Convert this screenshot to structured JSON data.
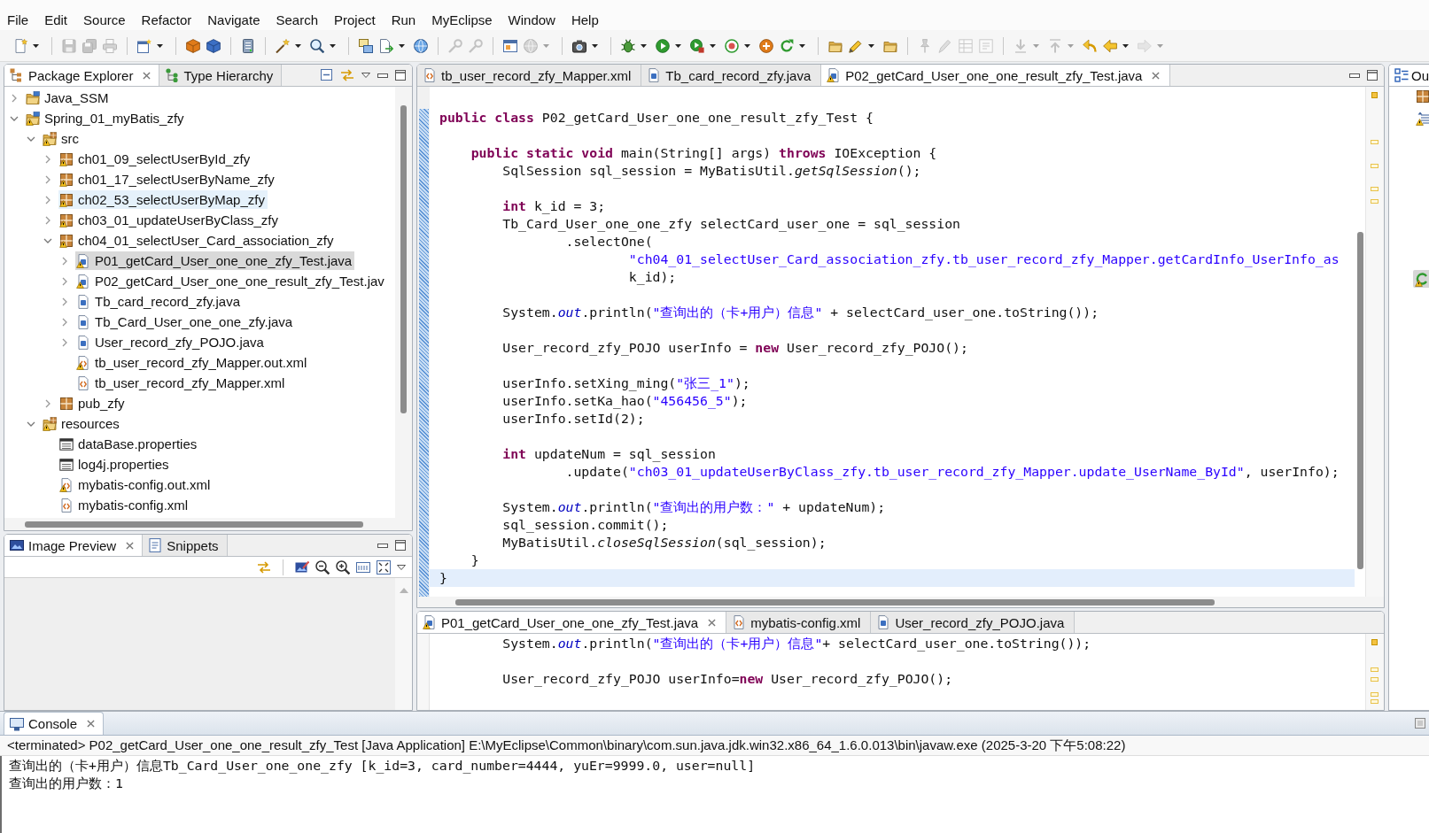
{
  "menu": {
    "items": [
      "File",
      "Edit",
      "Source",
      "Refactor",
      "Navigate",
      "Search",
      "Project",
      "Run",
      "MyEclipse",
      "Window",
      "Help"
    ]
  },
  "toolbar": {
    "buttons": [
      {
        "disabled": false
      },
      {
        "disabled": true
      },
      {
        "disabled": true
      },
      {
        "disabled": true
      },
      {
        "disabled": false
      },
      {
        "disabled": false
      },
      {
        "disabled": false
      },
      {
        "disabled": false
      },
      {
        "disabled": false
      },
      {
        "disabled": false
      },
      {
        "disabled": false
      },
      {
        "disabled": false
      },
      {
        "disabled": false
      },
      {
        "disabled": true
      },
      {
        "disabled": true
      },
      {
        "disabled": false
      },
      {
        "disabled": true
      },
      {
        "disabled": false
      },
      {
        "disabled": false
      },
      {
        "disabled": false
      },
      {
        "disabled": false
      },
      {
        "disabled": false
      },
      {
        "disabled": false
      },
      {
        "disabled": false
      },
      {
        "disabled": false
      },
      {
        "disabled": false
      },
      {
        "disabled": false
      },
      {
        "disabled": true
      },
      {
        "disabled": true
      },
      {
        "disabled": true
      },
      {
        "disabled": true
      },
      {
        "disabled": true
      },
      {
        "disabled": true
      },
      {
        "disabled": false
      },
      {
        "disabled": false
      },
      {
        "disabled": true
      }
    ]
  },
  "package_explorer": {
    "tabs": [
      {
        "label": "Package Explorer",
        "selected": true
      },
      {
        "label": "Type Hierarchy",
        "selected": false
      }
    ],
    "tree": [
      {
        "label": "Java_SSM",
        "kind": "project",
        "expanded": false,
        "warning": false,
        "selected": false,
        "hovered": false
      },
      {
        "label": "Spring_01_myBatis_zfy",
        "kind": "project",
        "expanded": true,
        "warning": true,
        "selected": false,
        "hovered": false,
        "children": [
          {
            "label": "src",
            "kind": "source-folder",
            "expanded": true,
            "warning": true,
            "selected": false,
            "hovered": false,
            "children": [
              {
                "label": "ch01_09_selectUserById_zfy",
                "kind": "package",
                "expanded": false,
                "warning": true,
                "selected": false,
                "hovered": false
              },
              {
                "label": "ch01_17_selectUserByName_zfy",
                "kind": "package",
                "expanded": false,
                "warning": true,
                "selected": false,
                "hovered": false
              },
              {
                "label": "ch02_53_selectUserByMap_zfy",
                "kind": "package",
                "expanded": false,
                "warning": true,
                "selected": false,
                "hovered": true
              },
              {
                "label": "ch03_01_updateUserByClass_zfy",
                "kind": "package",
                "expanded": false,
                "warning": true,
                "selected": false,
                "hovered": false
              },
              {
                "label": "ch04_01_selectUser_Card_association_zfy",
                "kind": "package",
                "expanded": true,
                "warning": true,
                "selected": false,
                "hovered": false,
                "children": [
                  {
                    "label": "P01_getCard_User_one_one_zfy_Test.java",
                    "kind": "java",
                    "expanded": false,
                    "warning": true,
                    "selected": true,
                    "hovered": false
                  },
                  {
                    "label": "P02_getCard_User_one_one_result_zfy_Test.jav",
                    "kind": "java",
                    "expanded": false,
                    "warning": true,
                    "selected": false,
                    "hovered": false
                  },
                  {
                    "label": "Tb_card_record_zfy.java",
                    "kind": "java",
                    "expanded": false,
                    "warning": false,
                    "selected": false,
                    "hovered": false
                  },
                  {
                    "label": "Tb_Card_User_one_one_zfy.java",
                    "kind": "java",
                    "expanded": false,
                    "warning": false,
                    "selected": false,
                    "hovered": false
                  },
                  {
                    "label": "User_record_zfy_POJO.java",
                    "kind": "java",
                    "expanded": false,
                    "warning": false,
                    "selected": false,
                    "hovered": false
                  },
                  {
                    "label": "tb_user_record_zfy_Mapper.out.xml",
                    "kind": "xml",
                    "warning": true,
                    "selected": false,
                    "hovered": false
                  },
                  {
                    "label": "tb_user_record_zfy_Mapper.xml",
                    "kind": "xml",
                    "warning": false,
                    "selected": false,
                    "hovered": false
                  }
                ]
              },
              {
                "label": "pub_zfy",
                "kind": "package",
                "expanded": false,
                "warning": false,
                "selected": false,
                "hovered": false
              }
            ]
          },
          {
            "label": "resources",
            "kind": "source-folder",
            "expanded": true,
            "warning": true,
            "selected": false,
            "hovered": false,
            "children": [
              {
                "label": "dataBase.properties",
                "kind": "properties",
                "warning": false,
                "selected": false,
                "hovered": false
              },
              {
                "label": "log4j.properties",
                "kind": "properties",
                "warning": false,
                "selected": false,
                "hovered": false
              },
              {
                "label": "mybatis-config.out.xml",
                "kind": "xml",
                "warning": true,
                "selected": false,
                "hovered": false
              },
              {
                "label": "mybatis-config.xml",
                "kind": "xml",
                "warning": false,
                "selected": false,
                "hovered": false
              }
            ]
          }
        ]
      }
    ]
  },
  "image_preview": {
    "tabs": [
      {
        "label": "Image Preview",
        "selected": true
      },
      {
        "label": "Snippets",
        "selected": false
      }
    ]
  },
  "editor": {
    "tabs": [
      {
        "label": "tb_user_record_zfy_Mapper.xml",
        "kind": "xml",
        "warning": false,
        "selected": false
      },
      {
        "label": "Tb_card_record_zfy.java",
        "kind": "java",
        "warning": false,
        "selected": false
      },
      {
        "label": "P02_getCard_User_one_one_result_zfy_Test.java",
        "kind": "java",
        "warning": true,
        "selected": true
      }
    ],
    "blocks": [
      {
        "lines": [
          {
            "tokens": [
              {
                "kind": "keyword",
                "text": "public class"
              },
              {
                "kind": "plain",
                "text": " P02_getCard_User_one_one_result_zfy_Test {"
              }
            ],
            "current": false
          }
        ]
      },
      {
        "lines": [
          {
            "tokens": [
              {
                "kind": "keyword",
                "text": "    public static void"
              },
              {
                "kind": "plain",
                "text": " main(String[] args) "
              },
              {
                "kind": "keyword",
                "text": "throws"
              },
              {
                "kind": "plain",
                "text": " IOException {"
              }
            ],
            "current": false
          },
          {
            "tokens": [
              {
                "kind": "plain",
                "text": "        SqlSession sql_session = MyBatisUtil."
              },
              {
                "kind": "static",
                "text": "getSqlSession"
              },
              {
                "kind": "plain",
                "text": "();"
              }
            ],
            "current": false
          }
        ]
      },
      {
        "lines": [
          {
            "tokens": [
              {
                "kind": "keyword",
                "text": "        int"
              },
              {
                "kind": "plain",
                "text": " k_id = 3;"
              }
            ],
            "current": false
          },
          {
            "tokens": [
              {
                "kind": "plain",
                "text": "        Tb_Card_User_one_one_zfy selectCard_user_one = sql_session"
              }
            ],
            "current": false
          },
          {
            "tokens": [
              {
                "kind": "plain",
                "text": "                .selectOne("
              }
            ],
            "current": false
          },
          {
            "tokens": [
              {
                "kind": "string",
                "text": "                        \"ch04_01_selectUser_Card_association_zfy.tb_user_record_zfy_Mapper.getCardInfo_UserInfo_as"
              }
            ],
            "current": false
          },
          {
            "tokens": [
              {
                "kind": "plain",
                "text": "                        k_id);"
              }
            ],
            "current": false
          }
        ]
      },
      {
        "lines": [
          {
            "tokens": [
              {
                "kind": "plain",
                "text": "        System."
              },
              {
                "kind": "field",
                "text": "out"
              },
              {
                "kind": "plain",
                "text": ".println("
              },
              {
                "kind": "string",
                "text": "\"查询出的（卡+用户）信息\""
              },
              {
                "kind": "plain",
                "text": " + selectCard_user_one.toString());"
              }
            ],
            "current": false
          }
        ]
      },
      {
        "lines": [
          {
            "tokens": [
              {
                "kind": "plain",
                "text": "        User_record_zfy_POJO userInfo = "
              },
              {
                "kind": "keyword",
                "text": "new"
              },
              {
                "kind": "plain",
                "text": " User_record_zfy_POJO();"
              }
            ],
            "current": false
          }
        ]
      },
      {
        "lines": [
          {
            "tokens": [
              {
                "kind": "plain",
                "text": "        userInfo.setXing_ming("
              },
              {
                "kind": "string",
                "text": "\"张三_1\""
              },
              {
                "kind": "plain",
                "text": ");"
              }
            ],
            "current": false
          },
          {
            "tokens": [
              {
                "kind": "plain",
                "text": "        userInfo.setKa_hao("
              },
              {
                "kind": "string",
                "text": "\"456456_5\""
              },
              {
                "kind": "plain",
                "text": ");"
              }
            ],
            "current": false
          },
          {
            "tokens": [
              {
                "kind": "plain",
                "text": "        userInfo.setId(2);"
              }
            ],
            "current": false
          }
        ]
      },
      {
        "lines": [
          {
            "tokens": [
              {
                "kind": "keyword",
                "text": "        int"
              },
              {
                "kind": "plain",
                "text": " updateNum = sql_session"
              }
            ],
            "current": false
          },
          {
            "tokens": [
              {
                "kind": "plain",
                "text": "                .update("
              },
              {
                "kind": "string",
                "text": "\"ch03_01_updateUserByClass_zfy.tb_user_record_zfy_Mapper.update_UserName_ById\""
              },
              {
                "kind": "plain",
                "text": ", userInfo);"
              }
            ],
            "current": false
          }
        ]
      },
      {
        "lines": [
          {
            "tokens": [
              {
                "kind": "plain",
                "text": "        System."
              },
              {
                "kind": "field",
                "text": "out"
              },
              {
                "kind": "plain",
                "text": ".println("
              },
              {
                "kind": "string",
                "text": "\"查询出的用户数：\""
              },
              {
                "kind": "plain",
                "text": " + updateNum);"
              }
            ],
            "current": false
          },
          {
            "tokens": [
              {
                "kind": "plain",
                "text": "        sql_session.commit();"
              }
            ],
            "current": false
          },
          {
            "tokens": [
              {
                "kind": "plain",
                "text": "        MyBatisUtil."
              },
              {
                "kind": "static",
                "text": "closeSqlSession"
              },
              {
                "kind": "plain",
                "text": "(sql_session);"
              }
            ],
            "current": false
          },
          {
            "tokens": [
              {
                "kind": "plain",
                "text": "    }"
              }
            ],
            "current": false
          },
          {
            "tokens": [
              {
                "kind": "plain",
                "text": "}"
              }
            ],
            "current": true
          }
        ]
      }
    ]
  },
  "lower_editor": {
    "tabs": [
      {
        "label": "P01_getCard_User_one_one_zfy_Test.java",
        "kind": "java",
        "warning": true,
        "selected": true
      },
      {
        "label": "mybatis-config.xml",
        "kind": "xml",
        "warning": false,
        "selected": false
      },
      {
        "label": "User_record_zfy_POJO.java",
        "kind": "java",
        "warning": false,
        "selected": false
      }
    ],
    "blocks": [
      {
        "lines": [
          {
            "tokens": [
              {
                "kind": "plain",
                "text": "        System."
              },
              {
                "kind": "field",
                "text": "out"
              },
              {
                "kind": "plain",
                "text": ".println("
              },
              {
                "kind": "string",
                "text": "\"查询出的（卡+用户）信息\""
              },
              {
                "kind": "plain",
                "text": "+ selectCard_user_one.toString());"
              }
            ],
            "current": false
          }
        ]
      },
      {
        "lines": [
          {
            "tokens": [
              {
                "kind": "plain",
                "text": "        User_record_zfy_POJO userInfo="
              },
              {
                "kind": "keyword",
                "text": "new"
              },
              {
                "kind": "plain",
                "text": " User_record_zfy_POJO();"
              }
            ],
            "current": false
          }
        ]
      }
    ]
  },
  "outline": {
    "tabs": [
      {
        "label": "Ou",
        "selected": true
      }
    ]
  },
  "console": {
    "tabs": [
      {
        "label": "Console",
        "selected": true
      }
    ],
    "status": "<terminated> P02_getCard_User_one_one_result_zfy_Test [Java Application] E:\\MyEclipse\\Common\\binary\\com.sun.java.jdk.win32.x86_64_1.6.0.013\\bin\\javaw.exe (2025-3-20 下午5:08:22)",
    "output": [
      "查询出的（卡+用户）信息Tb_Card_User_one_one_zfy [k_id=3, card_number=4444, yuEr=9999.0, user=null]",
      "查询出的用户数：1"
    ]
  }
}
